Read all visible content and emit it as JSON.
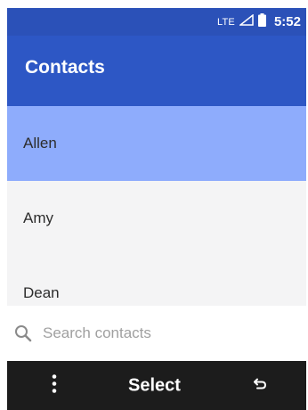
{
  "status_bar": {
    "network": "LTE",
    "time": "5:52",
    "icons": [
      "signal-icon",
      "battery-icon"
    ]
  },
  "app_bar": {
    "title": "Contacts"
  },
  "contacts": [
    {
      "name": "Allen",
      "selected": true
    },
    {
      "name": "Amy",
      "selected": false
    },
    {
      "name": "Dean",
      "selected": false
    }
  ],
  "search": {
    "placeholder": "Search contacts",
    "icon": "search-icon"
  },
  "softkeys": {
    "left_icon": "more-options-icon",
    "center_label": "Select",
    "right_icon": "back-icon"
  },
  "colors": {
    "status_bar": "#2b51b8",
    "app_bar": "#2d57c5",
    "selected_row": "#8eacfc",
    "list_background": "#f4f4f5",
    "softkey_bar": "#1c1c1c"
  }
}
